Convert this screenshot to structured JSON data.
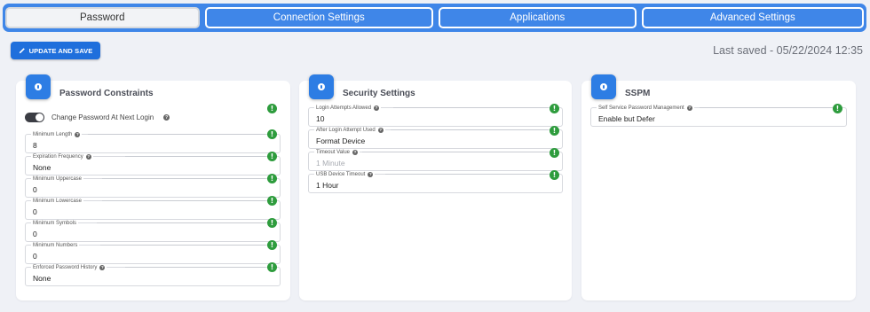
{
  "tabs": [
    {
      "label": "Password"
    },
    {
      "label": "Connection Settings"
    },
    {
      "label": "Applications"
    },
    {
      "label": "Advanced Settings"
    }
  ],
  "toolbar": {
    "update_label": "UPDATE AND SAVE",
    "last_saved": "Last saved - 05/22/2024 12:35"
  },
  "password_card": {
    "title": "Password Constraints",
    "toggle_label": "Change Password At Next Login",
    "fields": [
      {
        "label": "Minimum Length",
        "value": "8"
      },
      {
        "label": "Expiration Frequency",
        "value": "None"
      },
      {
        "label": "Minimum Uppercase",
        "value": "0"
      },
      {
        "label": "Minimum Lowercase",
        "value": "0"
      },
      {
        "label": "Minimum Symbols",
        "value": "0"
      },
      {
        "label": "Minimum Numbers",
        "value": "0"
      },
      {
        "label": "Enforced Password History",
        "value": "None"
      }
    ]
  },
  "security_card": {
    "title": "Security Settings",
    "fields": [
      {
        "label": "Login Attempts Allowed",
        "value": "10"
      },
      {
        "label": "After Login Attempt Used",
        "value": "Format Device"
      },
      {
        "label": "Timeout Value",
        "value": "1 Minute"
      },
      {
        "label": "USB Device Timeout",
        "value": "1 Hour"
      }
    ]
  },
  "sspm_card": {
    "title": "SSPM",
    "fields": [
      {
        "label": "Self Service Password Management",
        "value": "Enable but Defer"
      }
    ]
  },
  "icons": {
    "warning": "!",
    "help": "?"
  },
  "colors": {
    "tabbar": "#3f86e8",
    "primary_button": "#1f6fdc",
    "card_badge": "#2d7de4",
    "status_ok": "#2e9c3d"
  }
}
